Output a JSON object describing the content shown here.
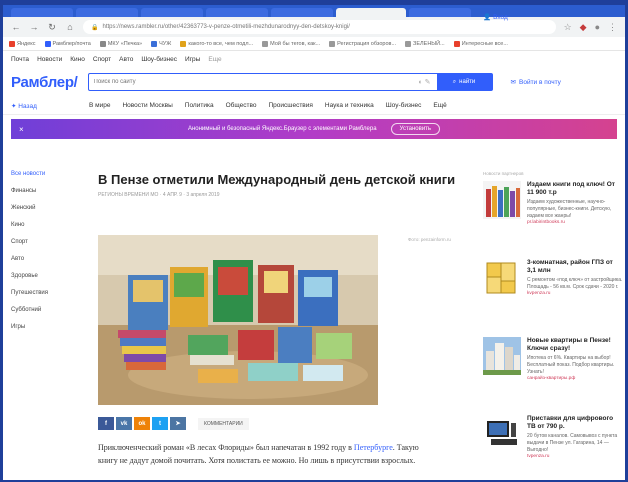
{
  "browser": {
    "url": "https://news.rambler.ru/other/42363773-v-penze-otmetili-mezhdunarodnyy-den-detskoy-knigi/",
    "bookmarks": [
      "Яндекс",
      "Рамблер/почта",
      "МКУ «Печка»",
      "ЧУЖ",
      "какого-то все, чем подл...",
      "Мой бы тегов, как...",
      "Регистрация обзоров...",
      "ЗЕЛЕНЫЙ...",
      "Интересные все..."
    ]
  },
  "topnav": {
    "items": [
      "Почта",
      "Новости",
      "Кино",
      "Спорт",
      "Авто",
      "Шоу-бизнес",
      "Игры",
      "Еще"
    ],
    "login": "Вход"
  },
  "header": {
    "logo": "Рамблер/",
    "search_placeholder": "Поиск по сайту",
    "search_button": "найти",
    "mail_link": "Войти в почту"
  },
  "secnav": {
    "home": "Назад",
    "items": [
      "В мире",
      "Новости Москвы",
      "Политика",
      "Общество",
      "Происшествия",
      "Наука и техника",
      "Шоу-бизнес",
      "Ещё"
    ]
  },
  "banner": {
    "text": "Анонимный и безопасный Яндекс.Браузер с элементами Рамблера",
    "install": "Установить"
  },
  "left_nav": [
    "Все новости",
    "Финансы",
    "Женский",
    "Кино",
    "Спорт",
    "Авто",
    "Здоровье",
    "Путешествия",
    "Субботний",
    "Игры"
  ],
  "article": {
    "title": "В Пензе отметили Международный день детской книги",
    "meta": "РЕГИОНЫ ВРЕМЕНИ МО · 4 АПР. 9 · 3 апреля 2019",
    "photo_credit": "Фото: penzainform.ru",
    "comments_label": "КОММЕНТАРИИ",
    "body_before_link": "Приключенческий роман «В лесах Флориды» был напечатан в 1992 году в ",
    "body_link": "Петербурге",
    "body_after_link": ". Такую книгу не дадут домой почитать. Хотя полистать ее можно. Но лишь в присутствии взрослых."
  },
  "sidebar": {
    "head": "Новости партнеров",
    "ads": [
      {
        "title": "Издаем книги под ключ! От 11 900 т.р",
        "text": "Издаем художественные, научно-популярные, бизнес-книги. Детскую, издаем все жанры!",
        "source": "pr.labirintbooks.ru"
      },
      {
        "title": "3-комнатная, район ГПЗ от 3,1 млн",
        "text": "С ремонтом «под ключ» от застройщика. Площадь - 56 кв.м. Срок сдачи - 2020 г.",
        "source": "kvpenza.ru"
      },
      {
        "title": "Новые квартиры в Пензе! Ключи сразу!",
        "text": "Ипотека от 6%. Квартиры на выбор! Бесплатный показ. Подбор квартиры. Узнать!",
        "source": "санрайз-квартиры.рф"
      },
      {
        "title": "Приставки для цифрового ТВ от 790 р.",
        "text": "20 бутов каналов. Самовывоз с пункта выдачи в Пензе ул. Гагарина, 14 — Выгодно!",
        "source": "tvpenza.ru"
      }
    ]
  },
  "colors": {
    "accent": "#315efb",
    "frame": "#1f3f9a"
  }
}
